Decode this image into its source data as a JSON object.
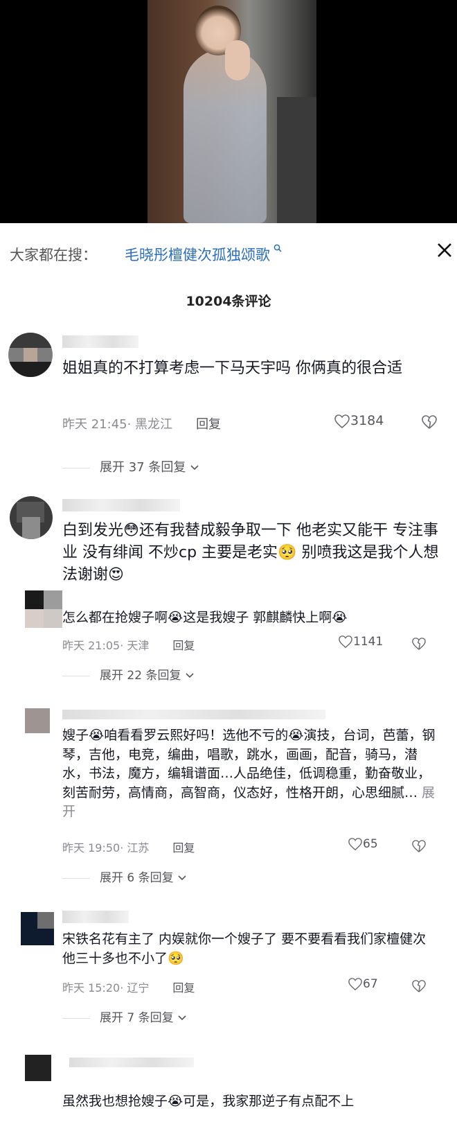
{
  "search": {
    "prefix": "大家都在搜：",
    "term": "毛晓彤檀健次孤独颂歌",
    "icon": "search-icon",
    "close_icon": "close-icon"
  },
  "comments_header": {
    "count_label": "10204条评论"
  },
  "comments": [
    {
      "text": "姐姐真的不打算考虑一下马天宇吗 你俩真的很合适",
      "time": "昨天 21:45",
      "location": "· 黑龙江",
      "reply_label": "回复",
      "likes": "3184",
      "expand_label": "展开 37 条回复"
    },
    {
      "text_parts": [
        "白到发光",
        "😳",
        "还有我替成毅争取一下 他老实又能干 专注事业 没有绯闻 不炒cp 主要是老实",
        "🥺",
        " 别喷我这是我个人想法谢谢",
        "😍"
      ]
    },
    {
      "text_parts": [
        "怎么都在抢嫂子啊",
        "😭",
        "这是我嫂子 郭麒麟快上啊",
        "😭"
      ],
      "time": "昨天 21:05",
      "location": "· 天津",
      "reply_label": "回复",
      "likes": "1141",
      "expand_label": "展开 22 条回复"
    },
    {
      "text_parts": [
        "嫂子",
        "😭",
        "咱看看罗云熙好吗！选他不亏的",
        "😭",
        "演技，台词，芭蕾，钢琴，吉他，电竞，编曲，唱歌，跳水，画画，配音，骑马，潜水，书法，魔方，编辑谱面…人品绝佳，低调稳重，勤奋敬业，刻苦耐劳，高情商，高智商，仪态好，性格开朗，心思细腻… "
      ],
      "more_label": "展开",
      "time": "昨天 19:50",
      "location": "· 江苏",
      "reply_label": "回复",
      "likes": "65",
      "expand_label": "展开 6 条回复"
    },
    {
      "text_parts": [
        "宋铁名花有主了 内娱就你一个嫂子了 要不要看看我们家檀健次 他三十多也不小了",
        "🥺"
      ],
      "time": "昨天 15:20",
      "location": "· 辽宁",
      "reply_label": "回复",
      "likes": "67",
      "expand_label": "展开 7 条回复"
    },
    {
      "text_parts": [
        "虽然我也想抢嫂子",
        "😭",
        "可是，我家那逆子有点配不上"
      ]
    }
  ],
  "icons": {
    "like": "heart-outline-icon",
    "dislike": "broken-heart-icon",
    "chevron": "chevron-down-icon"
  }
}
